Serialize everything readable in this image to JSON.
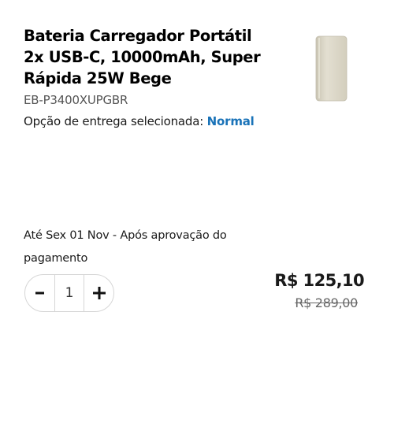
{
  "product": {
    "title": "Bateria Carregador Portátil 2x USB-C, 10000mAh, Super Rápida 25W Bege",
    "sku": "EB-P3400XUPGBR",
    "image_icon": "power-bank-beige",
    "image_color": "#dcd8c9"
  },
  "delivery": {
    "option_label": "Opção de entrega selecionada:",
    "option_value": "Normal",
    "option_value_color": "#1a73b8",
    "date_text": "Até Sex 01 Nov - Após aprovação do pagamento"
  },
  "quantity": {
    "decrement_icon": "minus-icon",
    "increment_icon": "plus-icon",
    "value": "1"
  },
  "pricing": {
    "price": "R$ 125,10",
    "original_price": "R$ 289,00"
  }
}
